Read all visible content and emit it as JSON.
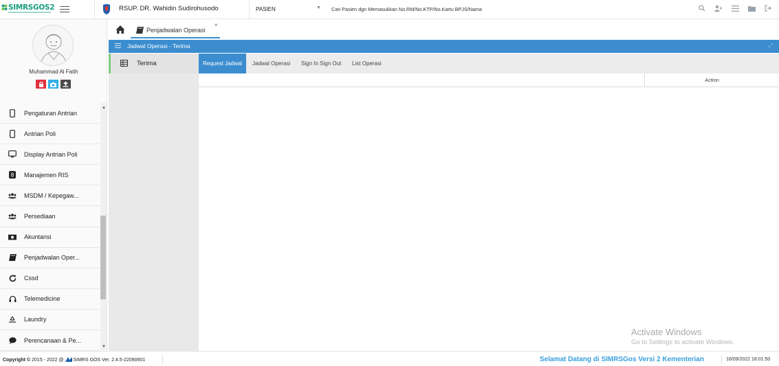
{
  "app": {
    "logo_text": "SIMRSGOS2",
    "hospital_name": "RSUP. DR. Wahidin Sudirohusodo",
    "search_category": "PASIEN",
    "search_placeholder": "Cari Pasien dgn Memasukkan No.RM/No.KTP/No.Kartu BPJS/Nama",
    "top_icons": [
      "search-icon",
      "add-user-icon",
      "list-icon",
      "folder-icon",
      "logout-icon"
    ]
  },
  "user": {
    "name": "Muhammad Al Fatih",
    "buttons": [
      {
        "icon": "lock-icon",
        "color": "#e0313c"
      },
      {
        "icon": "camera-icon",
        "color": "#31b0e8"
      },
      {
        "icon": "upload-icon",
        "color": "#4a4a4a"
      }
    ]
  },
  "sidebar": {
    "items": [
      {
        "label": "Pengaturan Antrian",
        "icon": "mobile-icon"
      },
      {
        "label": "Antrian Poli",
        "icon": "mobile-icon"
      },
      {
        "label": "Display Antrian Poli",
        "icon": "monitor-icon"
      },
      {
        "label": "Manajemen RIS",
        "icon": "ris-icon"
      },
      {
        "label": "MSDM / Kepegaw...",
        "icon": "users-icon"
      },
      {
        "label": "Persediaan",
        "icon": "users-icon"
      },
      {
        "label": "Akuntansi",
        "icon": "money-icon"
      },
      {
        "label": "Penjadwalan Oper...",
        "icon": "book-icon"
      },
      {
        "label": "Cssd",
        "icon": "refresh-icon"
      },
      {
        "label": "Telemedicine",
        "icon": "headset-icon"
      },
      {
        "label": "Laundry",
        "icon": "recycle-icon"
      },
      {
        "label": "Perencanaan & Pe...",
        "icon": "comment-icon"
      }
    ]
  },
  "tabs": {
    "active_label": "Penjadwalan Operasi",
    "close_symbol": "×"
  },
  "panel": {
    "title": "Jadwal Operasi - Terima",
    "left_item": "Terima",
    "subtabs": [
      "Request Jadwal",
      "Jadwal Operasi",
      "Sign In Sign Out",
      "List Operasi"
    ],
    "active_subtab": "Request Jadwal",
    "table_header_action": "Action"
  },
  "watermark": {
    "line1": "Activate Windows",
    "line2": "Go to Settings to activate Windows."
  },
  "footer": {
    "copyright_prefix": "Copyright",
    "copyright_years": "2015 - 2022 @",
    "version": "SIMRS GOS Ver. 2.4.5-22090601",
    "welcome": "Selamat Datang di SIMRSGos Versi 2 Kementerian",
    "datetime": "16/09/2022 18:01:50"
  },
  "colors": {
    "accent": "#3b8dcf",
    "active_marker": "#7ecb7e",
    "welcome_text": "#3aa0de"
  }
}
